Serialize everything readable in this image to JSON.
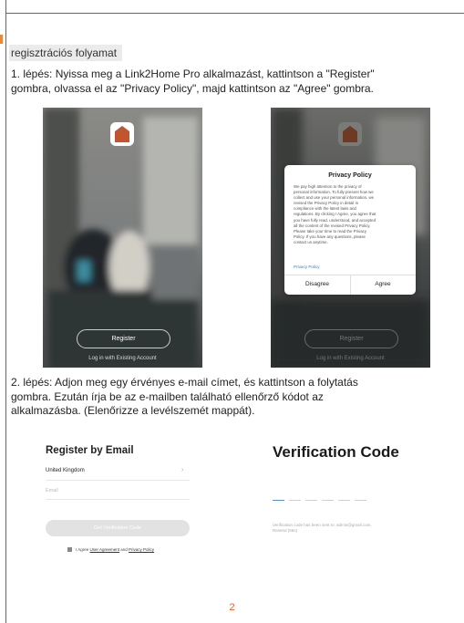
{
  "section_tag": "regisztrációs folyamat",
  "step1": {
    "line1": "1. lépés: Nyissa meg a Link2Home Pro alkalmazást, kattintson a \"Register\"",
    "line2": "gombra, olvassa el az \"Privacy Policy\", majd kattintson az \"Agree\" gombra."
  },
  "screen1": {
    "register_label": "Register",
    "login_link": "Log in with Existing Account"
  },
  "screen2": {
    "dialog_title": "Privacy Policy",
    "dialog_lines": [
      "We pay high attention to the privacy of",
      "personal information. To fully present how we",
      "collect and use your personal information, we",
      "revised the Privacy Policy in detail in",
      "compliance with the latest laws and",
      "regulations. By clicking I Agree, you agree that",
      "you have fully read, understood, and accepted",
      "all the content of the revised Privacy Policy.",
      "Please take your time to read the Privacy",
      "Policy. If you have any questions, please",
      "contact us anytime."
    ],
    "dialog_link": "Privacy Policy",
    "disagree_label": "Disagree",
    "agree_label": "Agree",
    "register_label": "Register",
    "login_link": "Log in with Existing Account"
  },
  "step2": {
    "line1": "2. lépés: Adjon meg egy érvényes e-mail címet, és kattintson a folytatás",
    "line2": "gombra. Ezután írja be az e-mailben található ellenőrző kódot az",
    "line3": "alkalmazásba. (Elenőrizze a levélszemét mappát)."
  },
  "register_email": {
    "title": "Register by Email",
    "country": "United Kingdom",
    "email_placeholder": "Email",
    "button": "Get Verification Code",
    "agree_prefix": "I Agree ",
    "user_agreement": "User Agreement",
    "and": " and ",
    "privacy_policy": "Privacy Policy"
  },
  "verification": {
    "title": "Verification Code",
    "sent_line1": "Verification code has been sent to: admin@gmail.com,",
    "sent_line2": "Resend (56s)"
  },
  "page_number": "2",
  "colors": {
    "accent": "#d9632a",
    "app_icon": "#c2552f",
    "link_blue": "#3a7fd5"
  }
}
